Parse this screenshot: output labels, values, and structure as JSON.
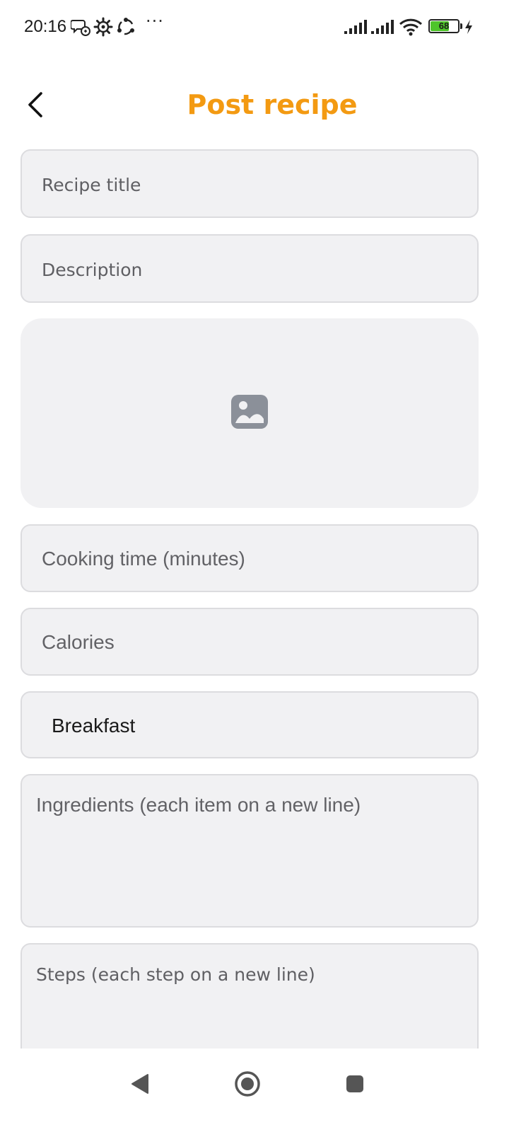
{
  "status_bar": {
    "time": "20:16",
    "dots": "···",
    "battery_level": "68",
    "battery_fraction": 0.68,
    "icons": [
      "chat-icon",
      "gear-icon",
      "sync-icon",
      "signal-icon",
      "signal-icon",
      "wifi-icon",
      "battery-icon",
      "charging-icon"
    ]
  },
  "header": {
    "title": "Post recipe",
    "back_icon": "chevron-left-icon",
    "title_color": "#f39a12"
  },
  "form": {
    "recipe_title_placeholder": "Recipe title",
    "description_placeholder": "Description",
    "image_icon": "image-icon",
    "cooking_time_placeholder": "Cooking time (minutes)",
    "calories_placeholder": "Calories",
    "category_value": "Breakfast",
    "ingredients_placeholder": "Ingredients (each item on a new line)",
    "steps_placeholder": "Steps (each step on a new line)"
  },
  "nav_bar": {
    "back_icon": "triangle-back-icon",
    "home_icon": "circle-home-icon",
    "recents_icon": "square-recents-icon"
  }
}
